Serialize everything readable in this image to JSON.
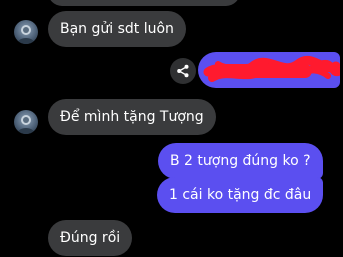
{
  "conversation": {
    "messages": [
      {
        "sender": "other",
        "text": "Bạn gửi sdt luôn"
      },
      {
        "sender": "me",
        "text": ""
      },
      {
        "sender": "other",
        "text": "Để mình tặng Tượng"
      },
      {
        "sender": "me",
        "text": "B 2 tượng đúng ko ?"
      },
      {
        "sender": "me",
        "text": "1 cái ko tặng đc đâu"
      },
      {
        "sender": "other",
        "text": "Đúng rồi"
      }
    ]
  },
  "icons": {
    "share": "share-icon",
    "avatar": "contact-avatar"
  },
  "colors": {
    "background": "#000000",
    "incoming_bubble": "#3a3b3d",
    "outgoing_bubble": "#5b4ff0",
    "redaction": "#ff1a2e"
  }
}
